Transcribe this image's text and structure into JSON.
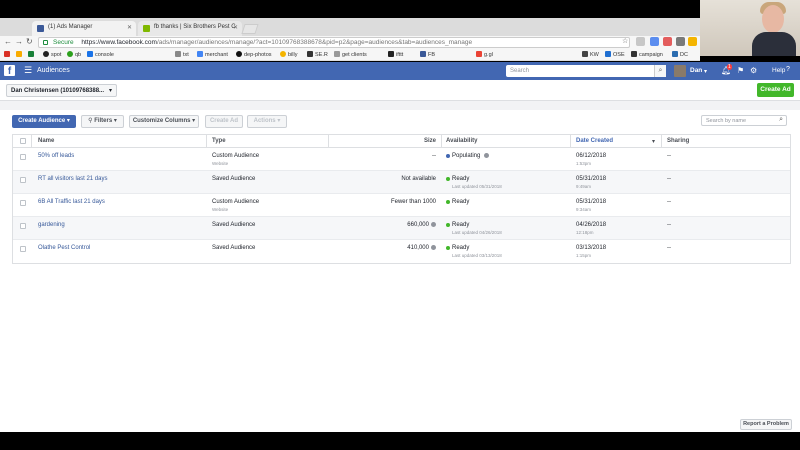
{
  "browser": {
    "tabs": [
      {
        "title": "(1) Ads Manager",
        "active": true
      },
      {
        "title": "fb thanks | Six Brothers Pest C",
        "active": false
      }
    ],
    "address": {
      "secure_label": "Secure",
      "url_host": "https://www.facebook.com",
      "url_path": "/ads/manager/audiences/manage/?act=10109768388678&pid=p2&page=audiences&tab=audiences_manage"
    },
    "bookmarks": [
      "spot",
      "qb",
      "console",
      "txt",
      "merchant",
      "dep-photos",
      "billy",
      "SE.R",
      "get clients",
      "ifttt",
      "FB",
      "g.gl",
      "KW",
      "OSE",
      "campaign",
      "DC"
    ]
  },
  "fb_header": {
    "logo": "f",
    "section_title": "Audiences",
    "search_placeholder": "Search",
    "user_name": "Dan",
    "notification_count": "1",
    "help_label": "Help"
  },
  "toolbar": {
    "account_label": "Dan Christensen (10109768388...",
    "create_ad_label": "Create Ad",
    "create_audience_label": "Create Audience",
    "filters_label": "Filters",
    "customize_columns_label": "Customize Columns",
    "create_ad_disabled_label": "Create Ad",
    "actions_label": "Actions",
    "search_placeholder": "Search by name"
  },
  "table": {
    "columns": {
      "name": "Name",
      "type": "Type",
      "size": "Size",
      "availability": "Availability",
      "date_created": "Date Created",
      "sharing": "Sharing"
    },
    "rows": [
      {
        "name": "50% off leads",
        "type": "Custom Audience",
        "type_sub": "Website",
        "size": "--",
        "availability": "Populating",
        "avail_sub": "",
        "status_color": "#4267b2",
        "date": "06/12/2018",
        "time": "1:53pm",
        "sharing": "--"
      },
      {
        "name": "RT all visitors last 21 days",
        "type": "Saved Audience",
        "type_sub": "",
        "size": "Not available",
        "availability": "Ready",
        "avail_sub": "Last updated 05/31/2018",
        "status_color": "#42b72a",
        "date": "05/31/2018",
        "time": "9:49am",
        "sharing": "--"
      },
      {
        "name": "6B All Traffic last 21 days",
        "type": "Custom Audience",
        "type_sub": "Website",
        "size": "Fewer than 1000",
        "availability": "Ready",
        "avail_sub": "",
        "status_color": "#42b72a",
        "date": "05/31/2018",
        "time": "9:34am",
        "sharing": "--"
      },
      {
        "name": "gardening",
        "type": "Saved Audience",
        "type_sub": "",
        "size": "660,000",
        "availability": "Ready",
        "avail_sub": "Last updated 04/26/2018",
        "status_color": "#42b72a",
        "date": "04/26/2018",
        "time": "12:18pm",
        "sharing": "--"
      },
      {
        "name": "Olathe Pest Control",
        "type": "Saved Audience",
        "type_sub": "",
        "size": "410,000",
        "availability": "Ready",
        "avail_sub": "Last updated 03/13/2018",
        "status_color": "#42b72a",
        "date": "03/13/2018",
        "time": "1:15pm",
        "sharing": "--"
      }
    ]
  },
  "footer": {
    "report_label": "Report a Problem"
  }
}
